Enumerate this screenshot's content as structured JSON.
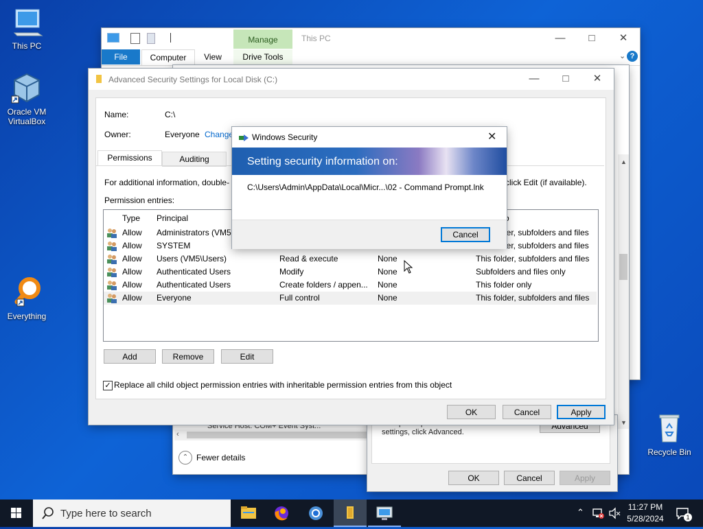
{
  "desktop": {
    "icons": [
      {
        "label": "This PC",
        "icon": "monitor-icon"
      },
      {
        "label": "Oracle VM VirtualBox",
        "icon": "virtualbox-cube-icon"
      },
      {
        "label": "Everything",
        "icon": "magnifier-icon"
      },
      {
        "label": "Recycle Bin",
        "icon": "recycle-bin-icon"
      }
    ]
  },
  "explorer": {
    "title": "This PC",
    "manage_tab": "Manage",
    "drive_tools_tab": "Drive Tools",
    "tabs": [
      "File",
      "Computer",
      "View"
    ],
    "column_stub": "P",
    "partial_row": "Service Host: COM+ Event Syst...",
    "fewer_details": "Fewer details"
  },
  "properties_dialog": {
    "special_text": "For special permissions or advanced settings, click Advanced.",
    "advanced_btn": "Advanced",
    "ok": "OK",
    "cancel": "Cancel",
    "apply": "Apply"
  },
  "advanced_dialog": {
    "title": "Advanced Security Settings for Local Disk (C:)",
    "name_label": "Name:",
    "name_value": "C:\\",
    "owner_label": "Owner:",
    "owner_value": "Everyone",
    "change_link": "Change",
    "tabs": [
      "Permissions",
      "Auditing"
    ],
    "info_text": "For additional information, double-",
    "info_text_tail": "click Edit (if available).",
    "permission_entries_label": "Permission entries:",
    "columns": {
      "type": "Type",
      "principal": "Principal",
      "applies_to": "o"
    },
    "entries": [
      {
        "type": "Allow",
        "principal": "Administrators (VM5",
        "access": "",
        "inherited": "",
        "applies": "ler, subfolders and files"
      },
      {
        "type": "Allow",
        "principal": "SYSTEM",
        "access": "",
        "inherited": "",
        "applies": "ler, subfolders and files"
      },
      {
        "type": "Allow",
        "principal": "Users (VM5\\Users)",
        "access": "Read & execute",
        "inherited": "None",
        "applies": "This folder, subfolders and files"
      },
      {
        "type": "Allow",
        "principal": "Authenticated Users",
        "access": "Modify",
        "inherited": "None",
        "applies": "Subfolders and files only"
      },
      {
        "type": "Allow",
        "principal": "Authenticated Users",
        "access": "Create folders / appen...",
        "inherited": "None",
        "applies": "This folder only"
      },
      {
        "type": "Allow",
        "principal": "Everyone",
        "access": "Full control",
        "inherited": "None",
        "applies": "This folder, subfolders and files"
      }
    ],
    "add": "Add",
    "remove": "Remove",
    "edit": "Edit",
    "replace_checkbox": "Replace all child object permission entries with inheritable permission entries from this object",
    "replace_checked": true,
    "ok": "OK",
    "cancel": "Cancel",
    "apply": "Apply"
  },
  "security_popup": {
    "title": "Windows Security",
    "heading": "Setting security information on:",
    "path": "C:\\Users\\Admin\\AppData\\Local\\Micr...\\02 - Command Prompt.lnk",
    "cancel": "Cancel"
  },
  "taskbar": {
    "search_placeholder": "Type here to search",
    "time": "11:27 PM",
    "date": "5/28/2024",
    "notification_count": "1"
  },
  "colors": {
    "accent": "#0078d7",
    "taskbar": "#101826",
    "link": "#0066cc"
  }
}
